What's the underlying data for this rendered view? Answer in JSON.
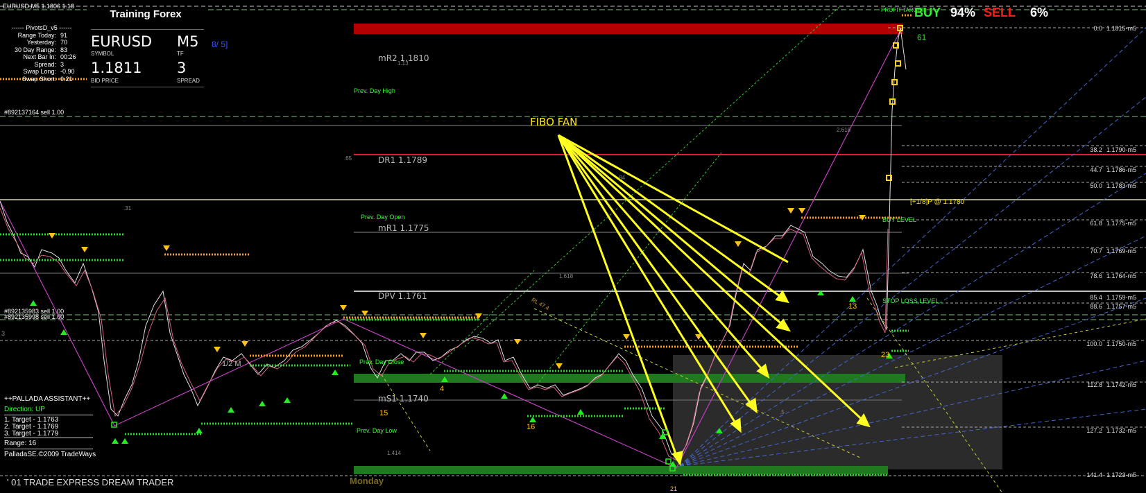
{
  "window": {
    "title": "EURUSD,M5  1.1806 1.18"
  },
  "pivots_panel": {
    "header": "------ PivotsD_v5 ------",
    "rows": [
      {
        "label": "Range  Today:",
        "value": "91"
      },
      {
        "label": "Yesterday:",
        "value": "70"
      },
      {
        "label": "30 Day Range:",
        "value": "83"
      },
      {
        "label": "Next Bar In:",
        "value": "00:26"
      },
      {
        "label": "Spread:",
        "value": "3"
      },
      {
        "label": "Swap  Long:",
        "value": "-0.90"
      },
      {
        "label": "Swap  Short:",
        "value": "0.21"
      }
    ]
  },
  "training_box": {
    "title": "Training Forex",
    "symbol": "EURUSD",
    "symbol_label": "SYMBOL",
    "timeframe": "M5",
    "timeframe_label": "TF",
    "bid": "1.1811",
    "bid_label": "BID PRICE",
    "spread": "3",
    "spread_label": "SPREAD",
    "side_tag": "8/ 5]"
  },
  "orders": {
    "order1": "#892137164 sell 1.00",
    "order2": "#892135983 sell 1.00",
    "order3": "#892135998 sell 1.00"
  },
  "buy_sell": {
    "buy_label": "BUY",
    "buy_value": "94%",
    "sell_label": "SELL",
    "sell_value": "6%",
    "profit_target": "PROFIT TARGET",
    "buy_level": "BUY LEVEL",
    "stop_loss": "STOP LOSS LEVEL",
    "plus_pivot": "[+1/8]P @ 1.1780"
  },
  "annotations": {
    "fibo_fan": "FIBO FAN",
    "monday": "Monday",
    "half_m": "1/2 M",
    "rl": "RL 47.4"
  },
  "pivot_levels": {
    "mr2": "mR2  1.1810",
    "dr1": "DR1  1.1789",
    "mr1": "mR1  1.1775",
    "dpv": "DPV  1.1761",
    "ms1": "mS1  1.1740",
    "prev_high": "Prev. Day High",
    "prev_open": "Prev. Day Open",
    "prev_low": "Prev. Day Low",
    "prev_close": "Prev. Day Close"
  },
  "fib_ratios": {
    "r1": ".65",
    "r2": ".31",
    "r3": "1.618",
    "r4": "2.618",
    "r5": "1.414",
    "r6": ".84",
    "r7": "1.13",
    "r8": ".5"
  },
  "wave_numbers": {
    "n15": "15",
    "n16": "16",
    "n4": "4",
    "n13": "13",
    "n23": "23",
    "n61": "61",
    "n21": "21",
    "n3": "3"
  },
  "pallada": {
    "title": "++PALLADA ASSISTANT++",
    "direction": "Direction: UP",
    "targets": [
      "1. Target - 1.1763",
      "2. Target - 1.1769",
      "3. Target - 1.1779"
    ],
    "range": "Range: 16",
    "copyright": "PalladaSE.©2009 TradeWays",
    "footer": "' 01 TRADE EXPRESS DREAM TRADER"
  },
  "price_scale": [
    {
      "pct": "0.0",
      "price": "1.1815",
      "tag": "m5"
    },
    {
      "pct": "38.2",
      "price": "1.1790",
      "tag": "m5"
    },
    {
      "pct": "44.7",
      "price": "1.1786",
      "tag": "m5"
    },
    {
      "pct": "50.0",
      "price": "1.1783",
      "tag": "m5"
    },
    {
      "pct": "61.8",
      "price": "1.1775",
      "tag": "m5"
    },
    {
      "pct": "70.7",
      "price": "1.1769",
      "tag": "m5"
    },
    {
      "pct": "78.6",
      "price": "1.1764",
      "tag": "m5"
    },
    {
      "pct": "85.4",
      "price": "1.1759",
      "tag": "m5"
    },
    {
      "pct": "88.6",
      "price": "1.1757",
      "tag": "m5"
    },
    {
      "pct": "100.0",
      "price": "1.1750",
      "tag": "m5"
    },
    {
      "pct": "112.8",
      "price": "1.1742",
      "tag": "m5"
    },
    {
      "pct": "127.2",
      "price": "1.1732",
      "tag": "m5"
    },
    {
      "pct": "141.4",
      "price": "1.1723",
      "tag": "m5"
    }
  ],
  "colors": {
    "candle_up": "#e6e6e6",
    "candle_down": "#d4607e",
    "dots_green": "#22dd22",
    "dots_orange": "#ff9a1a",
    "fan_yellow": "#ffff22",
    "red_band": "#b30000",
    "green_band": "#1f7a1f"
  }
}
